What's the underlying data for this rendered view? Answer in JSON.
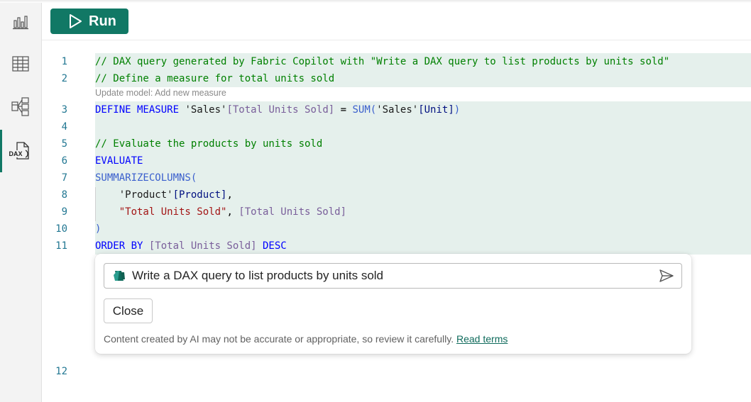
{
  "toolbar": {
    "run_label": "Run"
  },
  "sidebar": {
    "items": [
      {
        "name": "report-view",
        "icon": "bar-chart-icon"
      },
      {
        "name": "table-view",
        "icon": "table-grid-icon"
      },
      {
        "name": "model-view",
        "icon": "model-diagram-icon"
      },
      {
        "name": "dax-query-view",
        "icon": "dax-query-icon",
        "icon_text": "DAX",
        "active": true
      }
    ]
  },
  "editor": {
    "model_update_hint": "Update model: Add new measure",
    "lines": [
      {
        "num": "1",
        "tokens": [
          {
            "t": "// DAX query generated by Fabric Copilot with \"Write a DAX query to list products by units sold\"",
            "c": "c-com"
          }
        ]
      },
      {
        "num": "2",
        "tokens": [
          {
            "t": "// Define a measure for total units sold",
            "c": "c-com"
          }
        ]
      },
      {
        "num": "3",
        "tokens": [
          {
            "t": "DEFINE MEASURE ",
            "c": "c-kw"
          },
          {
            "t": "'Sales'",
            "c": "c-tbl"
          },
          {
            "t": "[Total Units Sold]",
            "c": "c-meas"
          },
          {
            "t": " = ",
            "c": "c-txt"
          },
          {
            "t": "SUM(",
            "c": "c-fn"
          },
          {
            "t": "'Sales'",
            "c": "c-tbl"
          },
          {
            "t": "[Unit]",
            "c": "c-col"
          },
          {
            "t": ")",
            "c": "c-fn"
          }
        ]
      },
      {
        "num": "4",
        "tokens": []
      },
      {
        "num": "5",
        "tokens": [
          {
            "t": "// Evaluate the products by units sold",
            "c": "c-com"
          }
        ]
      },
      {
        "num": "6",
        "tokens": [
          {
            "t": "EVALUATE",
            "c": "c-kw"
          }
        ]
      },
      {
        "num": "7",
        "tokens": [
          {
            "t": "SUMMARIZECOLUMNS(",
            "c": "c-fn"
          }
        ]
      },
      {
        "num": "8",
        "tokens": [
          {
            "t": "    ",
            "c": "c-txt"
          },
          {
            "t": "'Product'",
            "c": "c-tbl"
          },
          {
            "t": "[Product]",
            "c": "c-col"
          },
          {
            "t": ",",
            "c": "c-txt"
          }
        ]
      },
      {
        "num": "9",
        "tokens": [
          {
            "t": "    ",
            "c": "c-txt"
          },
          {
            "t": "\"Total Units Sold\"",
            "c": "c-str"
          },
          {
            "t": ", ",
            "c": "c-txt"
          },
          {
            "t": "[Total Units Sold]",
            "c": "c-meas"
          }
        ]
      },
      {
        "num": "10",
        "tokens": [
          {
            "t": ")",
            "c": "c-fn"
          }
        ]
      },
      {
        "num": "11",
        "tokens": [
          {
            "t": "ORDER BY ",
            "c": "c-kw"
          },
          {
            "t": "[Total Units Sold]",
            "c": "c-meas"
          },
          {
            "t": " DESC",
            "c": "c-kw"
          }
        ]
      },
      {
        "num": "12",
        "tokens": []
      }
    ]
  },
  "copilot": {
    "prompt_text": "Write a DAX query to list products by units sold",
    "close_label": "Close",
    "disclaimer": "Content created by AI may not be accurate or appropriate, so review it carefully.",
    "read_terms_label": "Read terms"
  },
  "colors": {
    "accent": "#117865",
    "highlight": "#e5f0ec",
    "comment": "#008000",
    "keyword": "#0000ff",
    "string": "#a31515",
    "line_number": "#237893"
  }
}
